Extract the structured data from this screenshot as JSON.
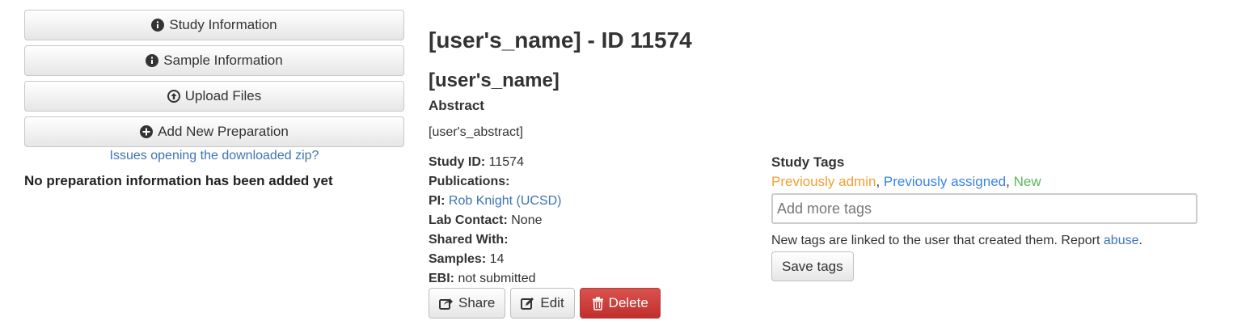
{
  "sidebar": {
    "buttons": [
      {
        "label": "Study Information",
        "icon": "info-circle-icon"
      },
      {
        "label": "Sample Information",
        "icon": "info-circle-icon"
      },
      {
        "label": "Upload Files",
        "icon": "upload-circle-icon"
      },
      {
        "label": "Add New Preparation",
        "icon": "plus-circle-icon"
      }
    ],
    "zip_link": "Issues opening the downloaded zip?",
    "no_prep_text": "No preparation information has been added yet"
  },
  "main": {
    "title": "[user's_name] - ID 11574",
    "study_name": "[user's_name]",
    "abstract_heading": "Abstract",
    "abstract_text": "[user's_abstract]",
    "info": {
      "study_id_label": "Study ID:",
      "study_id": "11574",
      "publications_label": "Publications:",
      "pi_label": "PI:",
      "pi": "Rob Knight (UCSD)",
      "lab_contact_label": "Lab Contact:",
      "lab_contact": "None",
      "shared_with_label": "Shared With:",
      "samples_label": "Samples:",
      "samples": "14",
      "ebi_label": "EBI:",
      "ebi": "not submitted"
    },
    "actions": {
      "share": "Share",
      "edit": "Edit",
      "delete": "Delete"
    }
  },
  "tags": {
    "heading": "Study Tags",
    "list": [
      {
        "label": "Previously admin",
        "color": "#f0a030"
      },
      {
        "label": "Previously assigned",
        "color": "#3a84e6"
      },
      {
        "label": "New",
        "color": "#5cb85c"
      }
    ],
    "separator": ",",
    "input_placeholder": "Add more tags",
    "note": "New tags are linked to the user that created them. Report",
    "note_link": "abuse",
    "note_end": ".",
    "save_label": "Save tags"
  },
  "colors": {
    "link": "#3c74b4",
    "danger": "#d9534f"
  }
}
